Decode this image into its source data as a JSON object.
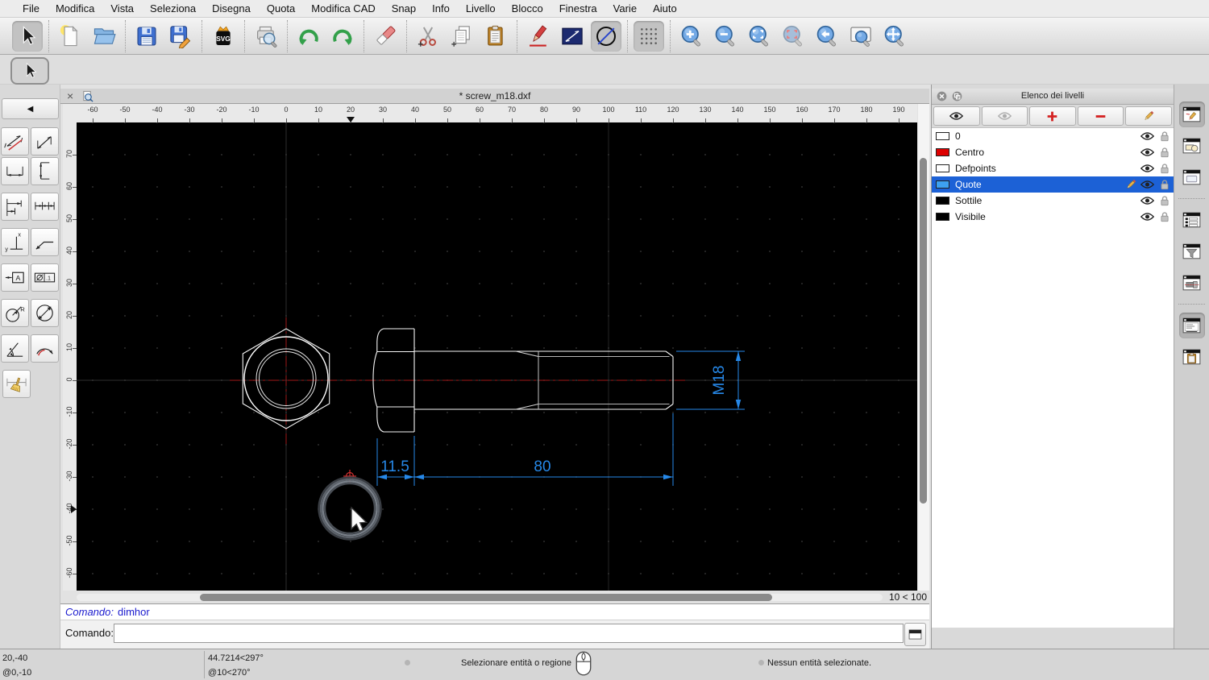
{
  "menu": {
    "items": [
      "File",
      "Modifica",
      "Vista",
      "Seleziona",
      "Disegna",
      "Quota",
      "Modifica CAD",
      "Snap",
      "Info",
      "Livello",
      "Blocco",
      "Finestra",
      "Varie",
      "Aiuto"
    ]
  },
  "toolbar": {
    "groups": [
      [
        "select-arrow"
      ],
      [
        "new-document",
        "open-file"
      ],
      [
        "save",
        "save-as"
      ],
      [
        "export-svg"
      ],
      [
        "print-preview"
      ],
      [
        "undo",
        "redo"
      ],
      [
        "eraser"
      ],
      [
        "cut",
        "copy",
        "paste"
      ],
      [
        "draw-pen",
        "draw-line",
        "draw-circle"
      ],
      [
        "snap-grid"
      ],
      [
        "zoom-in",
        "zoom-out",
        "zoom-auto",
        "zoom-select",
        "zoom-previous",
        "zoom-window",
        "zoom-pan"
      ]
    ],
    "pressed": [
      "select-arrow",
      "draw-circle",
      "snap-grid"
    ]
  },
  "left_toolbar": {
    "back_glyph": "◀",
    "groups": [
      [
        "dim-aligned",
        "dim-linear",
        "dim-horizontal",
        "dim-vertical"
      ],
      [
        "dim-baseline",
        "dim-continue"
      ],
      [
        "dim-ordinate",
        "dim-leader"
      ],
      [
        "dim-label",
        "dim-tolerance"
      ],
      [
        "dim-radial",
        "dim-diametric"
      ],
      [
        "dim-angular",
        "dim-arc"
      ],
      [
        "dim-cleanup"
      ]
    ]
  },
  "tab": {
    "close_glyph": "×",
    "title": "* screw_m18.dxf"
  },
  "rulers": {
    "h_ticks": [
      -60,
      -50,
      -40,
      -30,
      -20,
      -10,
      0,
      10,
      20,
      30,
      40,
      50,
      60,
      70,
      80,
      90,
      100,
      110,
      120,
      130,
      140,
      150,
      160,
      170,
      180,
      190
    ],
    "v_ticks": [
      70,
      60,
      50,
      40,
      30,
      20,
      10,
      0,
      -10,
      -20,
      -30,
      -40,
      -50,
      -60
    ],
    "h_marker": 20,
    "v_marker": -40
  },
  "drawing": {
    "dim_width": "11.5",
    "dim_length": "80",
    "dim_thread": "M18"
  },
  "scroll": {
    "zoom_indicator": "10 < 100"
  },
  "command": {
    "history_label": "Comando:",
    "history_command": "dimhor",
    "prompt_label": "Comando:",
    "input_value": "",
    "input_placeholder": ""
  },
  "layers_panel": {
    "title": "Elenco dei livelli",
    "buttons": [
      {
        "name": "show-all-layers",
        "icon": "eye"
      },
      {
        "name": "hide-all-layers",
        "icon": "eye-off"
      },
      {
        "name": "add-layer",
        "icon": "plus"
      },
      {
        "name": "remove-layer",
        "icon": "minus"
      },
      {
        "name": "edit-layer",
        "icon": "pencil"
      }
    ],
    "layers": [
      {
        "name": "0",
        "color": "#ffffff",
        "selected": false
      },
      {
        "name": "Centro",
        "color": "#dd0000",
        "selected": false
      },
      {
        "name": "Defpoints",
        "color": "#ffffff",
        "selected": false
      },
      {
        "name": "Quote",
        "color": "#3da0f0",
        "selected": true
      },
      {
        "name": "Sottile",
        "color": "#000000",
        "selected": false
      },
      {
        "name": "Visibile",
        "color": "#000000",
        "selected": false
      }
    ]
  },
  "dock": {
    "buttons": [
      {
        "icon": "layer-list",
        "pressed": true,
        "sep_before": false
      },
      {
        "icon": "block-list",
        "pressed": false,
        "sep_before": false
      },
      {
        "icon": "library",
        "pressed": false,
        "sep_before": false
      },
      {
        "icon": "entity-list",
        "pressed": false,
        "sep_before": true
      },
      {
        "icon": "filter",
        "pressed": false,
        "sep_before": false
      },
      {
        "icon": "view",
        "pressed": false,
        "sep_before": false
      },
      {
        "icon": "command",
        "pressed": true,
        "sep_before": true
      },
      {
        "icon": "clipboard",
        "pressed": false,
        "sep_before": false
      }
    ]
  },
  "statusbar": {
    "coord_abs": "20,-40",
    "coord_rel": "@0,-10",
    "polar_abs": "44.7214<297°",
    "polar_rel": "@10<270°",
    "hint": "Selezionare entità o regione",
    "selection_status": "Nessun entità selezionate."
  },
  "colors": {
    "dimension_blue": "#2688e8",
    "centerline_red": "#a01818",
    "selection_row_blue": "#1c61d6",
    "canvas_bg": "#000000"
  }
}
